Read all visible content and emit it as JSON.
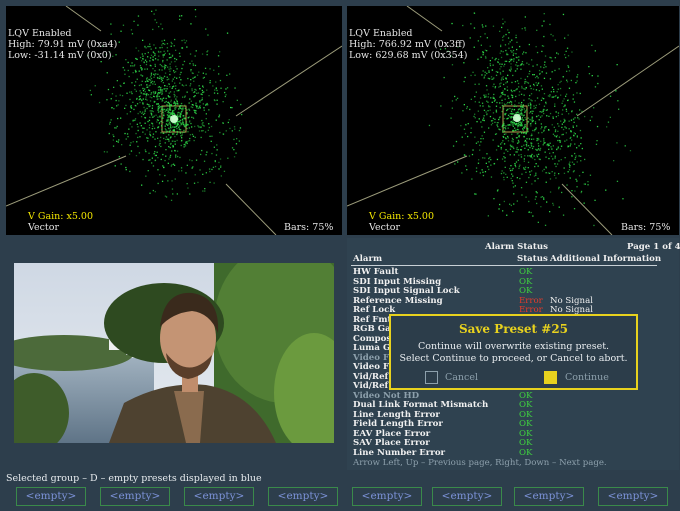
{
  "vector_left": {
    "lqv": "LQV Enabled",
    "high": "High: 79.91 mV (0xa4)",
    "low": "Low: -31.14 mV (0x0)",
    "gain": "V Gain: x5.00",
    "mode": "Vector",
    "bars": "Bars: 75%"
  },
  "vector_right": {
    "lqv": "LQV Enabled",
    "high": "High: 766.92 mV (0x3ff)",
    "low": "Low: 629.68 mV (0x354)",
    "gain": "V Gain: x5.00",
    "mode": "Vector",
    "bars": "Bars: 75%"
  },
  "alarm_panel": {
    "title": "Alarm Status",
    "page": "Page 1 of 4",
    "col_alarm": "Alarm",
    "col_status": "Status",
    "col_info": "Additional Information",
    "rows": [
      {
        "name": "HW Fault",
        "status": "OK",
        "info": ""
      },
      {
        "name": "SDI Input Missing",
        "status": "OK",
        "info": ""
      },
      {
        "name": "SDI Input Signal Lock",
        "status": "OK",
        "info": ""
      },
      {
        "name": "Reference Missing",
        "status": "Error",
        "info": "No Signal"
      },
      {
        "name": "Ref Lock",
        "status": "Error",
        "info": "No Signal"
      },
      {
        "name": "Ref Fmt",
        "status": "",
        "info": ""
      },
      {
        "name": "RGB Gam",
        "status": "",
        "info": ""
      },
      {
        "name": "Composi",
        "status": "",
        "info": ""
      },
      {
        "name": "Luma Ga",
        "status": "",
        "info": ""
      },
      {
        "name": "Video Fm",
        "status": "",
        "info": ""
      },
      {
        "name": "Video Fr",
        "status": "",
        "info": ""
      },
      {
        "name": "Vid/Ref",
        "status": "",
        "info": ""
      },
      {
        "name": "Vid/Ref",
        "status": "",
        "info": ""
      },
      {
        "name": "Video Not HD",
        "status": "OK",
        "info": ""
      },
      {
        "name": "Dual Link Format Mismatch",
        "status": "OK",
        "info": ""
      },
      {
        "name": "Line Length Error",
        "status": "OK",
        "info": ""
      },
      {
        "name": "Field Length Error",
        "status": "OK",
        "info": ""
      },
      {
        "name": "EAV Place Error",
        "status": "OK",
        "info": ""
      },
      {
        "name": "SAV Place Error",
        "status": "OK",
        "info": ""
      },
      {
        "name": "Line Number Error",
        "status": "OK",
        "info": ""
      }
    ],
    "footer": "Arrow Left, Up – Previous page, Right, Down – Next page."
  },
  "dialog": {
    "title": "Save Preset #25",
    "line1": "Continue will overwrite existing preset.",
    "line2": "Select Continue to proceed, or Cancel to abort.",
    "cancel": "Cancel",
    "continue": "Continue"
  },
  "status_text": "Selected group – D – empty presets displayed in blue",
  "presets": [
    "<empty>",
    "<empty>",
    "<empty>",
    "<empty>",
    "<empty>",
    "<empty>",
    "<empty>",
    "<empty>"
  ],
  "colors": {
    "vector_trace": "#2fdc4a",
    "ok": "#3fd13f",
    "error": "#e33b2c",
    "highlight": "#e8d21e",
    "preset_text": "#7c92d8",
    "background": "#2d3e4c"
  }
}
